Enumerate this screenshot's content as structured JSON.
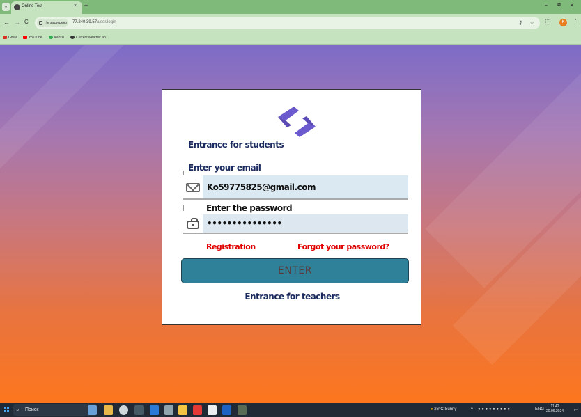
{
  "browser": {
    "tab_title": "Online Test",
    "tab_close": "×",
    "new_tab": "+",
    "tab_menu": "⌄",
    "window_controls": {
      "minimize": "–",
      "restore": "⧉",
      "close": "✕"
    },
    "nav": {
      "back": "←",
      "forward": "→",
      "reload": "C"
    },
    "security_chip": "Не защищено",
    "url_host": "77.240.39.57",
    "url_path": "/user/login",
    "profile_initial": "K",
    "bookmarks": [
      "Gmail",
      "YouTube",
      "Карты",
      "Current weather an..."
    ]
  },
  "login": {
    "heading": "Entrance for students",
    "email_label": "Enter your email",
    "email_value": "Ko59775825@gmail.com",
    "password_label": "Enter the password",
    "password_value": "•••••••••••••••",
    "registration_link": "Registration",
    "forgot_link": "Forgot your password?",
    "enter_button": "ENTER",
    "teachers_link": "Entrance for teachers"
  },
  "colors": {
    "button_bg": "#2f8199",
    "link_red": "#e00000",
    "heading_navy": "#1a2a5e",
    "logo_purple": "#6a5acd"
  },
  "taskbar": {
    "search_placeholder": "Поиск",
    "weather": "26°C  Sunny",
    "language": "ENG",
    "time": "11:42",
    "date": "20.06.2024"
  }
}
